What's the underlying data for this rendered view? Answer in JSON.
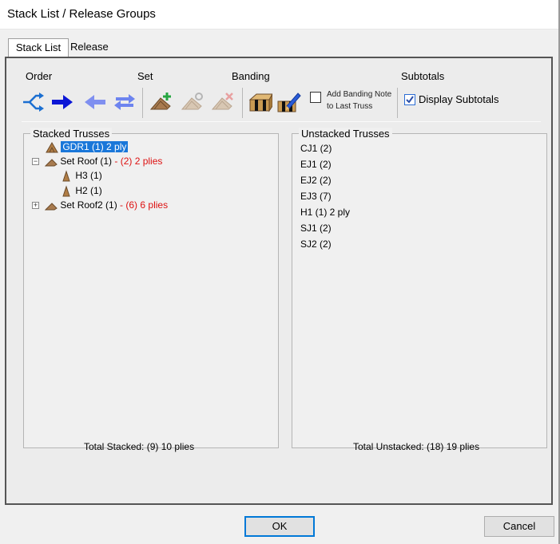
{
  "window": {
    "title": "Stack List / Release Groups"
  },
  "tabs": [
    {
      "label": "Stack List"
    },
    {
      "label": "Release Groups"
    }
  ],
  "toolbar": {
    "order_label": "Order",
    "set_label": "Set",
    "banding_label": "Banding",
    "subtotals_label": "Subtotals",
    "add_banding_note_line1": "Add Banding Note",
    "add_banding_note_line2": "to Last Truss",
    "add_banding_note_checked": false,
    "display_subtotals_label": "Display Subtotals",
    "display_subtotals_checked": true,
    "icons": [
      "shuffle-arrows-icon",
      "arrow-right-icon",
      "arrow-left-icon",
      "swap-arrows-icon",
      "add-set-icon",
      "edit-set-icon",
      "delete-set-icon",
      "banding-icon",
      "add-banding-note-icon"
    ]
  },
  "stacked": {
    "title": "Stacked Trusses",
    "rows": [
      {
        "label": "GDR1 (1) 2 ply",
        "suffix": "",
        "selected": true
      },
      {
        "label": "Set Roof (1)",
        "suffix": " -  (2) 2 plies",
        "expander": "−"
      },
      {
        "label": "H3 (1)",
        "suffix": ""
      },
      {
        "label": "H2 (1)",
        "suffix": ""
      },
      {
        "label": "Set Roof2 (1)",
        "suffix": " -  (6) 6 plies",
        "expander": "+"
      }
    ],
    "total": "Total Stacked: (9) 10 plies"
  },
  "unstacked": {
    "title": "Unstacked Trusses",
    "items": [
      "CJ1 (2)",
      "EJ1 (2)",
      "EJ2 (2)",
      "EJ3 (7)",
      "H1 (1) 2 ply",
      "SJ1 (2)",
      "SJ2 (2)"
    ],
    "total": "Total Unstacked: (18) 19 plies"
  },
  "buttons": {
    "ok": "OK",
    "cancel": "Cancel"
  }
}
